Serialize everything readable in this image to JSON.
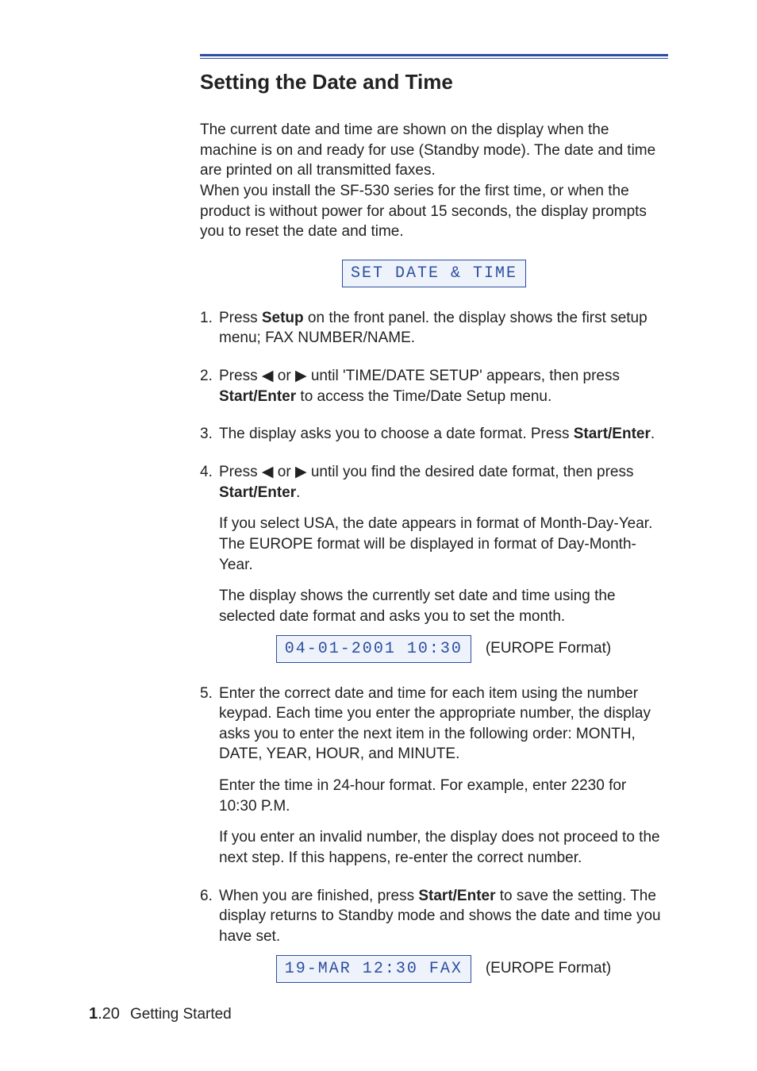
{
  "heading": "Setting the Date and Time",
  "intro": {
    "p1": "The current date and time are shown on the display when the machine is on and ready for use (Standby mode). The date and time are printed on all transmitted faxes.",
    "p2": "When you install the SF-530 series for the first time, or when the product is without power for about 15 seconds, the display prompts you to reset the date and time."
  },
  "lcd": {
    "set_date_time": "SET DATE & TIME",
    "date_time_value": "04-01-2001 10:30",
    "standby_value": "19-MAR 12:30 FAX",
    "europe_caption": "(EUROPE Format)"
  },
  "steps": {
    "s1": {
      "num": "1.",
      "pre": "Press ",
      "bold1": "Setup",
      "post": " on the front panel. the display shows the first setup menu; FAX NUMBER/NAME."
    },
    "s2": {
      "num": "2.",
      "pre": "Press ",
      "arrows_left": "➛",
      "or": " or ",
      "arrows_right": "❿",
      "mid": " until 'TIME/DATE SETUP' appears, then press ",
      "bold1": "Start/Enter",
      "post": " to access the Time/Date Setup menu."
    },
    "s3": {
      "num": "3.",
      "pre": "The display asks you to choose a date format. Press ",
      "bold1": "Start/Enter",
      "post": "."
    },
    "s4": {
      "num": "4.",
      "pre": "Press ",
      "arrows_left": "➛",
      "or": " or ",
      "arrows_right": "❿",
      "mid": " until you find the desired date format, then press ",
      "bold1": "Start/Enter",
      "post": ".",
      "sub1": "If you select USA, the date appears in format of Month-Day-Year. The EUROPE format will be displayed in format of Day-Month-Year.",
      "sub2": "The display shows the currently set date and time using the selected date format and asks you to set the month."
    },
    "s5": {
      "num": "5.",
      "text": "Enter the correct date and time for each item using the number keypad. Each time you enter the appropriate number, the display asks you to enter the next item in the following order: MONTH, DATE, YEAR, HOUR, and MINUTE.",
      "sub1": "Enter the time in 24-hour format. For example, enter 2230 for 10:30 P.M.",
      "sub2": "If you enter an invalid number, the display does not proceed to the next step. If this happens, re-enter the correct number."
    },
    "s6": {
      "num": "6.",
      "pre": "When you are finished, press ",
      "bold1": "Start/Enter",
      "post": " to save the setting. The display returns to Standby mode and shows the date and time you have set."
    }
  },
  "footer": {
    "chapter": "1",
    "page_rest": ".20",
    "section": "Getting Started"
  },
  "icons": {
    "left_arrow": "◀",
    "right_arrow": "▶"
  }
}
